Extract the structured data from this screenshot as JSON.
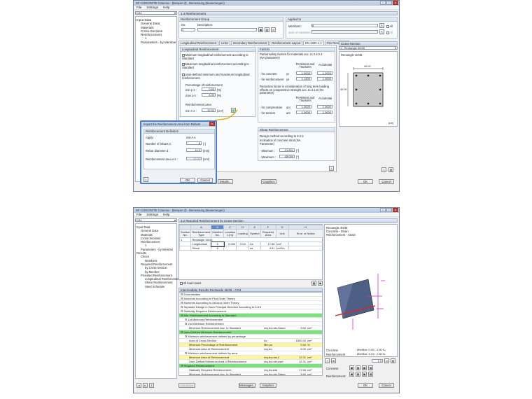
{
  "w1": {
    "title": "RF-CONCRETE Columns - [Beispiel 2] - Bemessung (Bewertungen)",
    "menu": [
      "File",
      "Settings",
      "Help"
    ],
    "case": "CA1",
    "tree": [
      "Input Data",
      "General Data",
      "Materials",
      "Cross-Sections",
      "Reinforcement",
      "1",
      "Parameters - by Member"
    ],
    "section_title": "1.4 Reinforcement",
    "group": {
      "header": "Reinforcement Group",
      "no_label": "No.",
      "desc_label": "Description:",
      "no_value": "1"
    },
    "applied": {
      "header": "Applied to",
      "members_label": "Members:",
      "members_value": "6",
      "sets_label": "Sets of members:",
      "all": "All"
    },
    "tabs": [
      "Longitudinal Reinforcement",
      "Links",
      "Secondary Reinforcement",
      "Reinforcement Layout",
      "EN 1992-1-1",
      "Fire Resistance"
    ],
    "long": {
      "header": "Longitudinal Reinforcement",
      "cb1": "Minimum longitudinal reinforcement according to Standard",
      "cb2": "Maximum longitudinal reinforcement according to Standard",
      "cb3": "User-defined minimum and maximum longitudinal reinforcement",
      "pct": "Percentage of reinforcement",
      "min_l": "min ρ s :",
      "min_v": "0.50",
      "max_l": "max ρ s :",
      "max_v": "4.00",
      "unit_pct": "[%]",
      "area": "Reinforcement area",
      "area_l": "min A s :",
      "area_v": "12.32",
      "unit_area": "[cm²]"
    },
    "factors": {
      "header": "Factors",
      "desc": "Partial safety factors for materials acc. to 2.4.2.4 (NA parameter)",
      "col1": "Persistent and Transient",
      "col2": "Accidental",
      "r1": "- for concrete",
      "r1s": "γc",
      "r1a": "1.5000",
      "r1b": "1.2000",
      "r2": "- for reinforcement",
      "r2s": "γs",
      "r2a": "1.1500",
      "r2b": "1.0000",
      "desc2": "Reduction factor in consideration of long term loading effects on compressive strength acc. to 3.1.6 (NA parameter)",
      "r3": "- for compression",
      "r3s": "αcc",
      "r3a": "1.0000",
      "r3b": "1.0000",
      "r4": "- for tension",
      "r4s": "αct",
      "r4a": "1.0000",
      "r4b": "1.0000"
    },
    "shear": {
      "header": "Shear Reinforcement",
      "l1": "Design method according to 6.2.3",
      "l2": "Inclination of concrete strut (NA Parameter)",
      "min_l": "- Minimum :",
      "min_v": "21.801",
      "max_l": "- Maximum :",
      "max_v": "45.000",
      "unit": "[°]"
    },
    "cs": {
      "header": "Cross-Section",
      "select": "1 - Rectangle 40/45",
      "name": "Rectangle 40/45",
      "dim_top": "40.00",
      "dim_side": "45.00",
      "unit": "[cm]"
    },
    "buttons": {
      "details": "Details...",
      "graphics": "Graphics",
      "ok": "OK",
      "cancel": "Cancel"
    },
    "dialog": {
      "title": "Import the Reinforcement Area from Rebars",
      "header": "Reinforcement Definition",
      "apply": "Apply:",
      "apply_v": "min A s",
      "n_l": "Number of rebars n :",
      "n_v": "8",
      "n_u": "[-]",
      "d_l": "Rebar diameter d :",
      "d_v": "14.0",
      "d_u": "[mm]",
      "a_l": "Reinforcement area A s :",
      "a_v": "12.32",
      "a_u": "[cm²]",
      "ok": "OK",
      "cancel": "Cancel"
    }
  },
  "w2": {
    "title": "RF-CONCRETE Columns - [Beispiel 2] - Bemessung (Bewertungen)",
    "menu": [
      "File",
      "Settings",
      "Help"
    ],
    "case": "CA1",
    "tree": [
      "Input Data",
      "General Data",
      "Materials",
      "Cross-Sections",
      "Reinforcement",
      "1",
      "Parameters - by Member",
      "Results",
      "Check",
      "Members",
      "Required Reinforcement",
      "by Cross-Section",
      "by Member",
      "Provided Reinforcement",
      "Longitudinal Reinforcement",
      "Shear Reinforcement",
      "Steel Schedule"
    ],
    "section_title": "3.2 Required Reinforcement by Cross-Section",
    "grid": {
      "letters": [
        "A",
        "B",
        "C",
        "D",
        "E",
        "F",
        "G",
        "H"
      ],
      "cols": [
        "Section No.",
        "Reinforcement Type",
        "Member No.",
        "Location x [m]",
        "Loading",
        "Symbol",
        "Required Area",
        "Unit",
        "Error or Notice"
      ],
      "group": "Rectangle 40/45",
      "rows": [
        [
          "",
          "Longitudinal",
          "6",
          "0.000",
          "CO4",
          "As",
          "17.56",
          "cm²",
          ""
        ],
        [
          "",
          "Shear",
          "6",
          "",
          "",
          "as",
          "4.91",
          "cm²/m",
          ""
        ]
      ],
      "sec_no": "1"
    },
    "legend": {
      "l1": "Rectangle 40/45",
      "l2": "Concrete - Strain",
      "l3": "Reinforcement - Strain"
    },
    "all_loads": "All load cases",
    "inter_title": "Intermediate Results Rectangle 40/45 - CO4",
    "inter": [
      {
        "t": "Eccentricities",
        "lvl": 0,
        "c": ""
      },
      {
        "t": "Moments According to First Order Theory",
        "lvl": 0,
        "c": ""
      },
      {
        "t": "Moments According to Second Order Theory",
        "lvl": 0,
        "c": ""
      },
      {
        "t": "Separate Design in Each Principal Direction According to 5.8.9",
        "lvl": 0,
        "c": ""
      },
      {
        "t": "Statically Required Reinforcement",
        "lvl": 0,
        "c": ""
      },
      {
        "t": "Min. Reinforcement According to Standard",
        "lvl": 0,
        "c": "g"
      },
      {
        "t": "1st Minimum Reinforcement",
        "lvl": 1,
        "c": ""
      },
      {
        "t": "2nd Minimum Reinforcement",
        "lvl": 1,
        "c": ""
      },
      {
        "t": "Minimum Reinforcement Acc. to Standard",
        "lvl": 2,
        "c": "",
        "s": "req As,min,Stand",
        "v": "3.60",
        "u": "cm²"
      },
      {
        "t": "User-Defined Minimum Reinforcement",
        "lvl": 0,
        "c": "g"
      },
      {
        "t": "Minimum reinforcement defined by percentage",
        "lvl": 1,
        "c": ""
      },
      {
        "t": "Area of Cross-Section",
        "lvl": 2,
        "c": "",
        "s": "Ac",
        "v": "1800.00",
        "u": "cm²"
      },
      {
        "t": "Minimum Percentage of Reinforcement",
        "lvl": 2,
        "c": "y",
        "s": "Min ρs",
        "v": "0.50",
        "u": "%"
      },
      {
        "t": "Minimum Area of Reinforcement",
        "lvl": 2,
        "c": "",
        "s": "req As",
        "v": "9.00",
        "u": "cm²"
      },
      {
        "t": "Minimum reinforcement defined by area",
        "lvl": 1,
        "c": ""
      },
      {
        "t": "Minimum Area of Reinforcement",
        "lvl": 2,
        "c": "y",
        "s": "req As,min,2",
        "v": "12.31",
        "u": "cm²"
      },
      {
        "t": "User-Defined Minimum Area of Reinforcement",
        "lvl": 2,
        "c": "",
        "s": "req As,min,user",
        "v": "12.31",
        "u": "cm²"
      },
      {
        "t": "Required Reinforcement",
        "lvl": 0,
        "c": "g"
      },
      {
        "t": "Statically Required Reinforcement",
        "lvl": 2,
        "c": "",
        "s": "req As,stat",
        "v": "17.56",
        "u": "cm²"
      },
      {
        "t": "Minimum Reinforcement Acc. to Standard",
        "lvl": 2,
        "c": "",
        "s": "req As,min,Stand",
        "v": "3.60",
        "u": "cm²"
      },
      {
        "t": "User-Defined Minimum Reinforcement",
        "lvl": 2,
        "c": "",
        "s": "req As,min,user",
        "v": "12.31",
        "u": "cm²"
      },
      {
        "t": "Required Reinforcement",
        "lvl": 2,
        "c": "",
        "s": "req As",
        "v": "17.56",
        "u": "cm²"
      }
    ],
    "strain": {
      "c_l": "Concrete",
      "c_v": "Min/Max: 0.00 / -3.50 ‰",
      "r_l": "Reinforcement",
      "r_v": "Min/Max: 5.24 / -2.66 ‰",
      "zoom": "1.0"
    },
    "side": {
      "concrete": "Concrete:",
      "reinforcement": "Reinforcement:"
    },
    "buttons": {
      "calculation": "Calculation",
      "messages": "Messages...",
      "graphics": "Graphics",
      "ok": "OK",
      "cancel": "Cancel"
    }
  }
}
